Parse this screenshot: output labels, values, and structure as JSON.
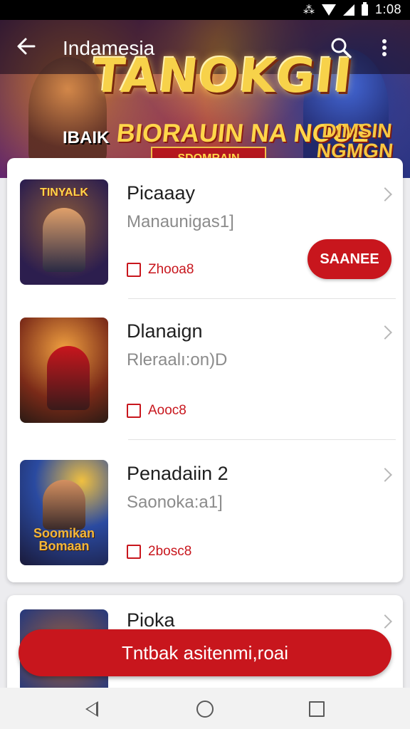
{
  "status_bar": {
    "time": "1:08"
  },
  "toolbar": {
    "title": "Indamesia"
  },
  "banner": {
    "logo": "TANOKGII",
    "left_text": "IBAIK",
    "main_text": "BIORAUIN NA NOOE",
    "ribbon": "SDOMRAIN",
    "right_text": "DIMSIN NGMGN"
  },
  "items": [
    {
      "title": "Picaaay",
      "subtitle": "Manaunigas1]",
      "tag": "Zhooa8",
      "thumb_label": "TINYALK",
      "save_label": "SAANEE"
    },
    {
      "title": "Dlanaign",
      "subtitle": "Rleraalı:on)D",
      "tag": "Aooc8",
      "thumb_label": ""
    },
    {
      "title": "Penadaiin 2",
      "subtitle": "Saonoka:a1]",
      "tag": "2bosc8",
      "thumb_label": "Soomikan Bomaan"
    },
    {
      "title": "Pioka",
      "subtitle": "",
      "tag": "",
      "thumb_label": ""
    }
  ],
  "cta": {
    "label": "Tntbak asitenmi,roai"
  },
  "colors": {
    "accent": "#c8161d",
    "background": "#ececef"
  },
  "icons": [
    "back-arrow-icon",
    "search-icon",
    "more-vert-icon",
    "chevron-right-icon",
    "bookmark-icon",
    "nav-back-icon",
    "nav-home-icon",
    "nav-recent-icon"
  ]
}
